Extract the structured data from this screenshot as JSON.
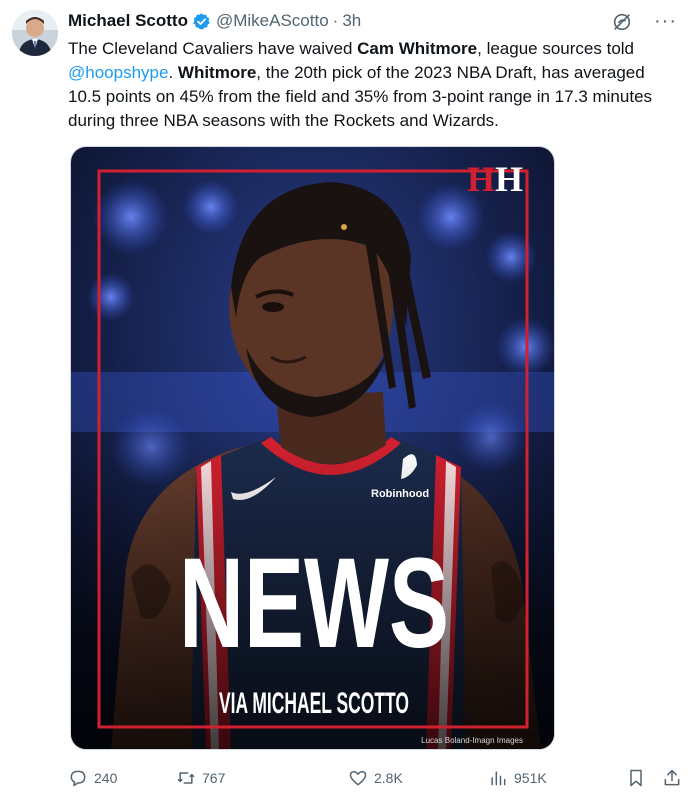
{
  "author": {
    "name": "Michael Scotto",
    "handle": "@MikeAScotto",
    "separator": "·",
    "time": "3h"
  },
  "tweet": {
    "t1": "The Cleveland Cavaliers have waived ",
    "t2": "Cam Whitmore",
    "t3": ", league sources told ",
    "mention": "@hoopshype",
    "t4": ". ",
    "t5": "Whitmore",
    "t6": ", the 20th pick of the 2023 NBA Draft, has averaged 10.5 points on 45% from the field and 35% from 3-point range in 17.3 minutes during three NBA seasons with the Rockets and Wizards."
  },
  "media": {
    "logo_h1": "H",
    "logo_h2": "H",
    "sponsor": "Robinhood",
    "headline": "NEWS",
    "byline": "VIA MICHAEL SCOTTO",
    "credit": "Lucas Boland-Imagn Images",
    "colors": {
      "frame": "#d1202f",
      "logo_red": "#d1202f",
      "jersey": "#1b2a4a"
    }
  },
  "actions": {
    "replies": "240",
    "reposts": "767",
    "likes": "2.8K",
    "views": "951K"
  },
  "colors": {
    "accent": "#1d9bf0",
    "muted": "#536471",
    "text": "#0f1419"
  }
}
